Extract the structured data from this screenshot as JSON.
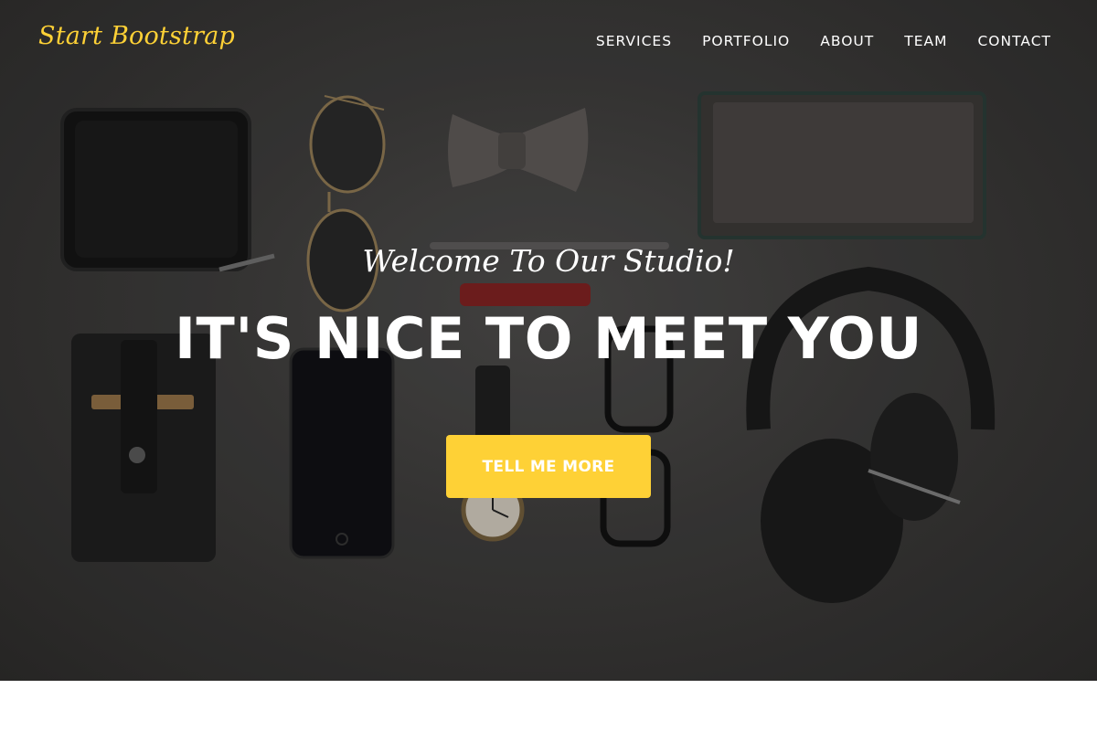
{
  "brand": {
    "name": "Start Bootstrap",
    "color": "#fed136"
  },
  "nav": {
    "items": [
      {
        "label": "SERVICES"
      },
      {
        "label": "PORTFOLIO"
      },
      {
        "label": "ABOUT"
      },
      {
        "label": "TEAM"
      },
      {
        "label": "CONTACT"
      }
    ]
  },
  "hero": {
    "subheading": "Welcome To Our Studio!",
    "heading": "IT'S NICE TO MEET YOU",
    "cta_label": "TELL ME MORE",
    "accent_color": "#fed136",
    "background_image": "flat-lay-accessories-photo"
  }
}
